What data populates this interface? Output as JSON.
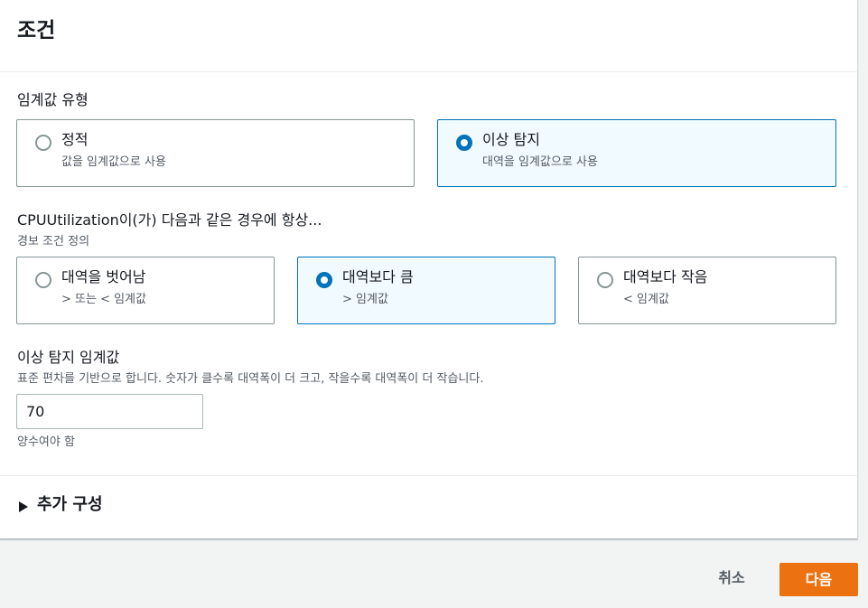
{
  "panel": {
    "title": "조건"
  },
  "threshold_type": {
    "label": "임계값 유형",
    "options": [
      {
        "title": "정적",
        "desc": "값을 임계값으로 사용",
        "selected": false
      },
      {
        "title": "이상 탐지",
        "desc": "대역을 임계값으로 사용",
        "selected": true
      }
    ]
  },
  "condition": {
    "label": "CPUUtilization이(가) 다음과 같은 경우에 항상...",
    "desc": "경보 조건 정의",
    "options": [
      {
        "title": "대역을 벗어남",
        "desc": "> 또는 < 임계값",
        "selected": false
      },
      {
        "title": "대역보다 큼",
        "desc": "> 임계값",
        "selected": true
      },
      {
        "title": "대역보다 작음",
        "desc": "< 임계값",
        "selected": false
      }
    ]
  },
  "anomaly_threshold": {
    "label": "이상 탐지 임계값",
    "desc": "표준 편차를 기반으로 합니다. 숫자가 클수록 대역폭이 더 크고, 작을수록 대역폭이 더 작습니다.",
    "value": "70",
    "constraint": "양수여야 함"
  },
  "additional": {
    "label": "추가 구성"
  },
  "footer": {
    "cancel": "취소",
    "next": "다음"
  },
  "colors": {
    "accent": "#0073bb",
    "primary_button": "#ec7211"
  }
}
